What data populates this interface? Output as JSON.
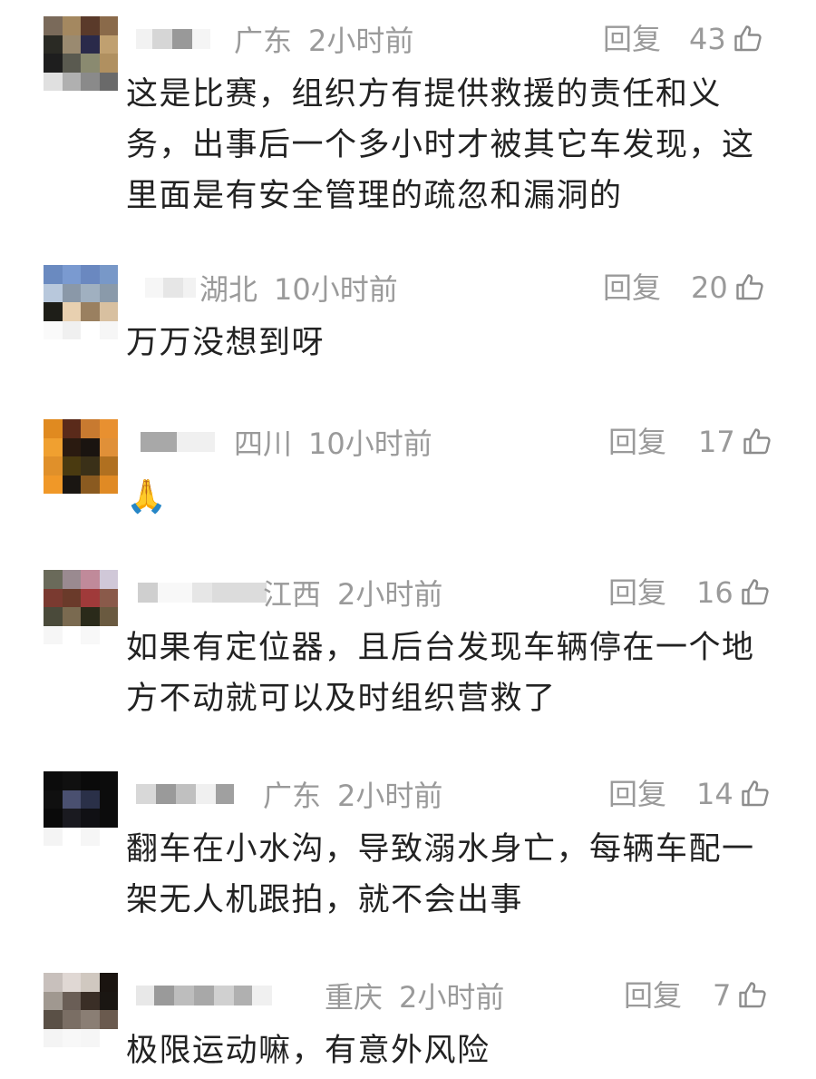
{
  "comments": [
    {
      "region": "广东",
      "time": "2小时前",
      "reply_label": "回复",
      "likes": "43",
      "text": "这是比赛，组织方有提供救援的责任和义务，出事后一个多小时才被其它车发现，这里面是有安全管理的疏忽和漏洞的"
    },
    {
      "region": "湖北",
      "time": "10小时前",
      "reply_label": "回复",
      "likes": "20",
      "text": "万万没想到呀"
    },
    {
      "region": "四川",
      "time": "10小时前",
      "reply_label": "回复",
      "likes": "17",
      "text": "🙏"
    },
    {
      "region": "江西",
      "time": "2小时前",
      "reply_label": "回复",
      "likes": "16",
      "text": "如果有定位器，且后台发现车辆停在一个地方不动就可以及时组织营救了"
    },
    {
      "region": "广东",
      "time": "2小时前",
      "reply_label": "回复",
      "likes": "14",
      "text": "翻车在小水沟，导致溺水身亡，每辆车配一架无人机跟拍，就不会出事"
    },
    {
      "region": "重庆",
      "time": "2小时前",
      "reply_label": "回复",
      "likes": "7",
      "text": "极限运动嘛，有意外风险"
    }
  ]
}
